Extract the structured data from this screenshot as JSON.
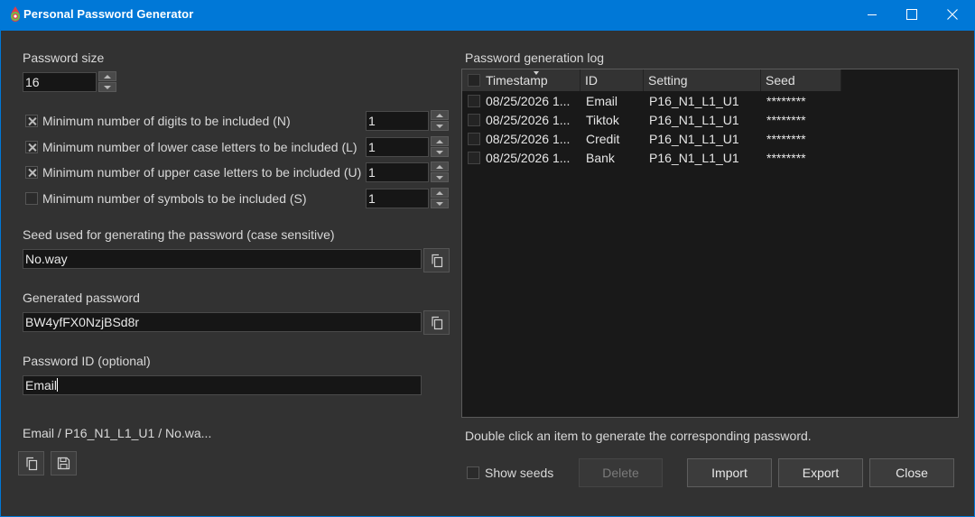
{
  "window": {
    "title": "Personal Password Generator",
    "accent": "#0078d7",
    "background": "#323232"
  },
  "password_size": {
    "label": "Password size",
    "value": "16"
  },
  "options": [
    {
      "label": "Minimum number of digits to be included (N)",
      "checked": true,
      "value": "1"
    },
    {
      "label": "Minimum number of lower case letters to be included (L)",
      "checked": true,
      "value": "1"
    },
    {
      "label": "Minimum number of upper case letters to be included (U)",
      "checked": true,
      "value": "1"
    },
    {
      "label": "Minimum number of symbols to be included (S)",
      "checked": false,
      "value": "1"
    }
  ],
  "seed": {
    "label": "Seed used for generating the password (case sensitive)",
    "value": "No.way"
  },
  "generated": {
    "label": "Generated password",
    "value": "BW4yfFX0NzjBSd8r"
  },
  "password_id": {
    "label": "Password ID (optional)",
    "value": "Email"
  },
  "summary": "Email / P16_N1_L1_U1 / No.wa...",
  "log": {
    "label": "Password generation log",
    "columns": [
      "Timestamp",
      "ID",
      "Setting",
      "Seed"
    ],
    "rows": [
      {
        "timestamp": "08/25/2026 1...",
        "id": "Email",
        "setting": "P16_N1_L1_U1",
        "seed": "********"
      },
      {
        "timestamp": "08/25/2026 1...",
        "id": "Tiktok",
        "setting": "P16_N1_L1_U1",
        "seed": "********"
      },
      {
        "timestamp": "08/25/2026 1...",
        "id": "Credit",
        "setting": "P16_N1_L1_U1",
        "seed": "********"
      },
      {
        "timestamp": "08/25/2026 1...",
        "id": "Bank",
        "setting": "P16_N1_L1_U1",
        "seed": "********"
      }
    ],
    "hint": "Double click an item to generate the corresponding password."
  },
  "controls": {
    "show_seeds": "Show seeds",
    "delete": "Delete",
    "import": "Import",
    "export": "Export",
    "close": "Close"
  }
}
